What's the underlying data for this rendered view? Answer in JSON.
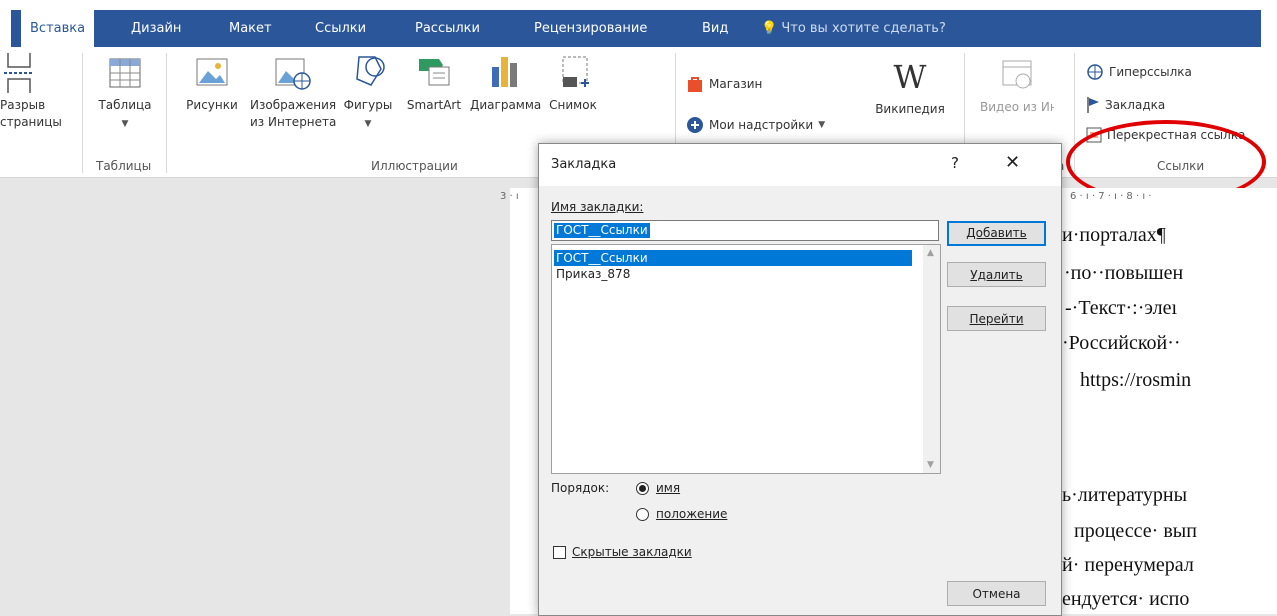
{
  "tabs": [
    {
      "label": "Вставка",
      "active": true
    },
    {
      "label": "Дизайн"
    },
    {
      "label": "Макет"
    },
    {
      "label": "Ссылки"
    },
    {
      "label": "Рассылки"
    },
    {
      "label": "Рецензирование"
    },
    {
      "label": "Вид"
    }
  ],
  "tellme": "Что вы хотите сделать?",
  "ribbon": {
    "page_break": {
      "line1": "Разрыв",
      "line2": "страницы"
    },
    "table": "Таблица",
    "tables_group": "Таблицы",
    "pictures": "Рисунки",
    "online_pictures": {
      "line1": "Изображения",
      "line2": "из Интернета"
    },
    "shapes": "Фигуры",
    "smartart": "SmartArt",
    "chart": "Диаграмма",
    "screenshot": "Снимок",
    "illustrations_group": "Иллюстрации",
    "store": "Магазин",
    "my_addins": "Мои надстройки",
    "wikipedia": "Википедия",
    "online_video": "Видео из Интернета",
    "hyperlink": "Гиперссылка",
    "bookmark": "Закладка",
    "cross_reference": "Перекрестная ссылка",
    "links_group": "Ссылки",
    "media_group_tail": "а",
    "colors": {
      "tab_blue": "#2b579a",
      "highlight_red": "#e00000",
      "select_blue": "#0078d7"
    }
  },
  "ruler": {
    "left": "3 · ı",
    "right": "6 · ı · 7 · ı · 8 · ı ·"
  },
  "document": {
    "lines": [
      "и·порталах¶",
      "·по··повышен",
      "-·Текст·:·элеı",
      "·Российской··",
      "https://rosmin",
      "ь·литературны",
      "процессе· вып",
      "й· перенумерал",
      "ендуется· испо"
    ]
  },
  "dialog": {
    "title": "Закладка",
    "help": "?",
    "close": "✕",
    "name_label": "Имя закладки:",
    "name_value": "ГОСТ__Ссылки",
    "bookmarks": [
      "ГОСТ__Ссылки",
      "Приказ_878"
    ],
    "selected_index": 0,
    "buttons": {
      "add": "Добавить",
      "delete": "Удалить",
      "goto": "Перейти",
      "cancel": "Отмена"
    },
    "order_label": "Порядок:",
    "order_options": [
      "имя",
      "положение"
    ],
    "order_selected": "имя",
    "hidden_label": "Скрытые закладки",
    "hidden_checked": false
  }
}
